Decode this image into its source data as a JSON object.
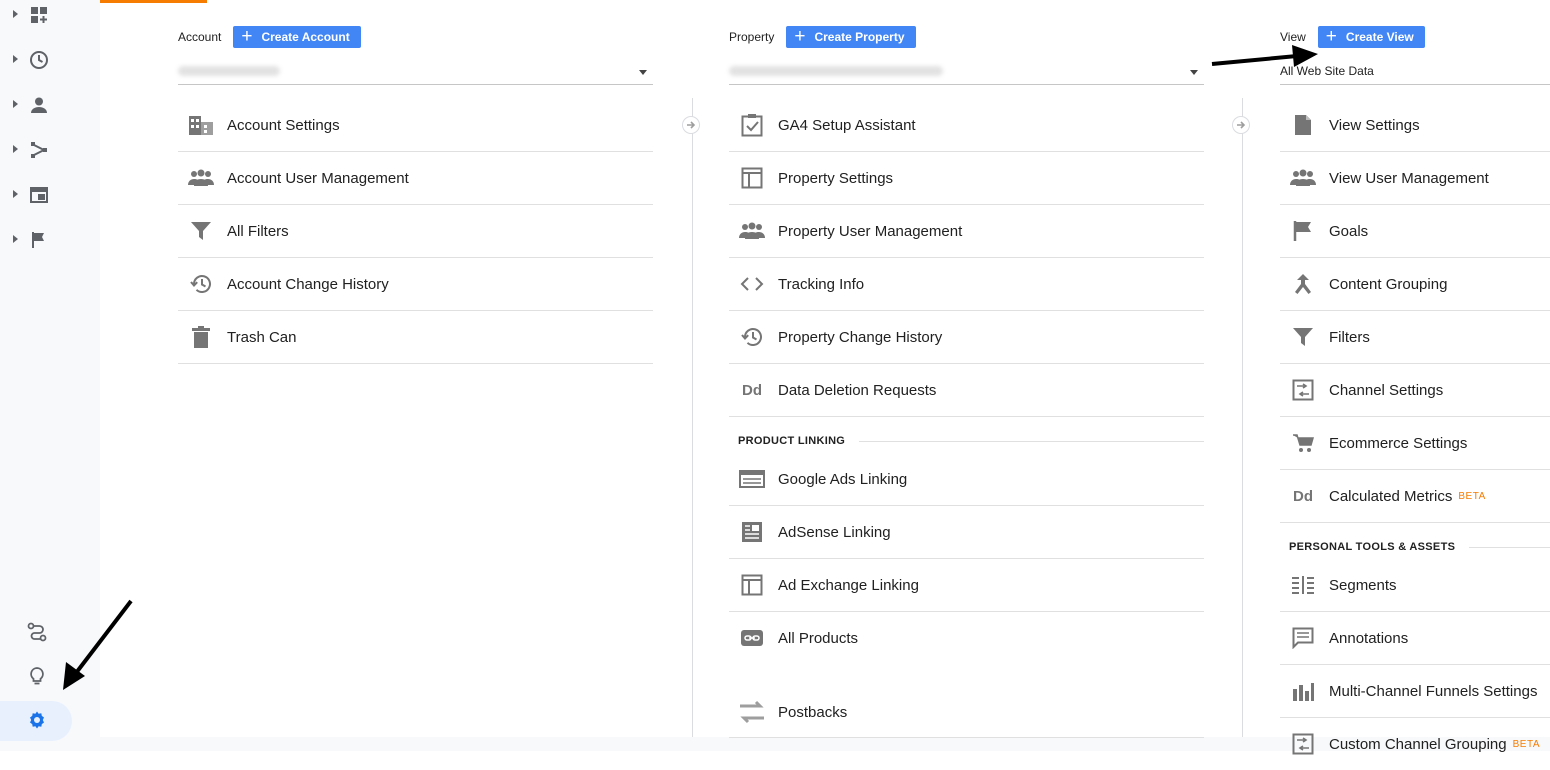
{
  "left_rail": {
    "items": [
      {
        "name": "customization",
        "icon": "dashboard-plus-icon"
      },
      {
        "name": "realtime",
        "icon": "clock-icon"
      },
      {
        "name": "audience",
        "icon": "person-icon"
      },
      {
        "name": "acquisition",
        "icon": "acquisition-icon"
      },
      {
        "name": "behavior",
        "icon": "browser-window-icon"
      },
      {
        "name": "conversions",
        "icon": "flag-icon"
      }
    ],
    "bottom": [
      {
        "name": "attribution",
        "icon": "path-icon"
      },
      {
        "name": "discover",
        "icon": "lightbulb-icon"
      },
      {
        "name": "admin",
        "icon": "gear-icon",
        "active": true
      }
    ]
  },
  "account": {
    "label": "Account",
    "create_label": "Create Account",
    "items": [
      {
        "label": "Account Settings",
        "icon": "building-icon"
      },
      {
        "label": "Account User Management",
        "icon": "people-icon"
      },
      {
        "label": "All Filters",
        "icon": "filter-icon"
      },
      {
        "label": "Account Change History",
        "icon": "history-icon"
      },
      {
        "label": "Trash Can",
        "icon": "trash-icon"
      }
    ]
  },
  "property": {
    "label": "Property",
    "create_label": "Create Property",
    "items": [
      {
        "label": "GA4 Setup Assistant",
        "icon": "clipboard-check-icon"
      },
      {
        "label": "Property Settings",
        "icon": "layout-icon"
      },
      {
        "label": "Property User Management",
        "icon": "people-icon"
      },
      {
        "label": "Tracking Info",
        "icon": "code-icon"
      },
      {
        "label": "Property Change History",
        "icon": "history-icon"
      },
      {
        "label": "Data Deletion Requests",
        "icon": "dd-icon"
      }
    ],
    "section_title": "PRODUCT LINKING",
    "linking": [
      {
        "label": "Google Ads Linking",
        "icon": "ads-icon"
      },
      {
        "label": "AdSense Linking",
        "icon": "adsense-icon"
      },
      {
        "label": "Ad Exchange Linking",
        "icon": "layout-icon"
      },
      {
        "label": "All Products",
        "icon": "link-icon"
      }
    ],
    "extra": [
      {
        "label": "Postbacks",
        "icon": "postback-icon"
      }
    ]
  },
  "view": {
    "label": "View",
    "create_label": "Create View",
    "selected": "All Web Site Data",
    "items": [
      {
        "label": "View Settings",
        "icon": "document-icon"
      },
      {
        "label": "View User Management",
        "icon": "people-icon"
      },
      {
        "label": "Goals",
        "icon": "flag-icon"
      },
      {
        "label": "Content Grouping",
        "icon": "merge-icon"
      },
      {
        "label": "Filters",
        "icon": "filter-icon"
      },
      {
        "label": "Channel Settings",
        "icon": "channel-icon"
      },
      {
        "label": "Ecommerce Settings",
        "icon": "cart-icon"
      },
      {
        "label": "Calculated Metrics",
        "icon": "dd-icon",
        "badge": "BETA"
      }
    ],
    "section_title": "PERSONAL TOOLS & ASSETS",
    "tools": [
      {
        "label": "Segments",
        "icon": "segments-icon"
      },
      {
        "label": "Annotations",
        "icon": "comment-icon"
      },
      {
        "label": "Multi-Channel Funnels Settings",
        "icon": "bar-chart-icon"
      },
      {
        "label": "Custom Channel Grouping",
        "icon": "channel-icon",
        "badge": "BETA"
      }
    ]
  },
  "colors": {
    "accent": "#4285f4",
    "beta": "#f57c00",
    "icon": "#757575"
  }
}
